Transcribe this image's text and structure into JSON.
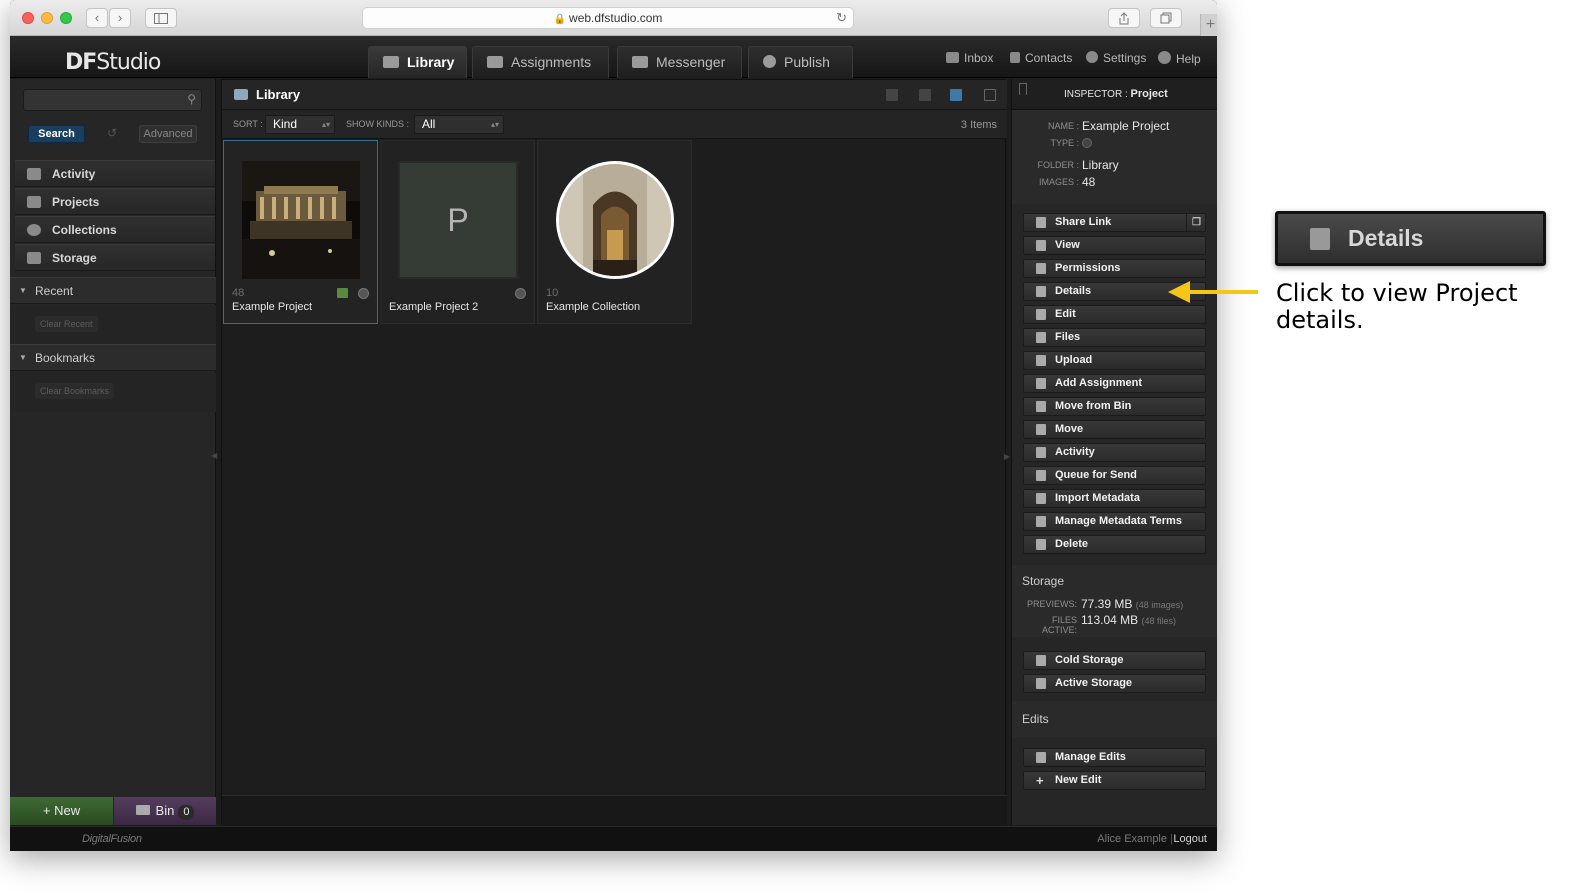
{
  "browser": {
    "url": "web.dfstudio.com",
    "back": "‹",
    "forward": "›",
    "lock": "🔒",
    "reload": "↻",
    "new_tab": "+"
  },
  "app": {
    "logo_a": "DF",
    "logo_b": "Studio",
    "tabs": [
      {
        "label": "Library",
        "icon": "library-icon"
      },
      {
        "label": "Assignments",
        "icon": "assignments-icon"
      },
      {
        "label": "Messenger",
        "icon": "messenger-icon"
      },
      {
        "label": "Publish",
        "icon": "publish-icon"
      }
    ],
    "top_links": [
      {
        "label": "Inbox",
        "icon": "inbox-icon"
      },
      {
        "label": "Contacts",
        "icon": "contacts-icon"
      },
      {
        "label": "Settings",
        "icon": "gear-icon"
      },
      {
        "label": "Help",
        "icon": "help-icon"
      }
    ]
  },
  "sidebar": {
    "search_label": "Search",
    "advanced_label": "Advanced",
    "reset_glyph": "↺",
    "search_glyph": "⚲",
    "items": [
      {
        "label": "Activity",
        "icon": "activity-icon"
      },
      {
        "label": "Projects",
        "icon": "projects-icon"
      },
      {
        "label": "Collections",
        "icon": "collections-icon"
      },
      {
        "label": "Storage",
        "icon": "storage-icon"
      }
    ],
    "recent_label": "Recent",
    "clear_recent": "Clear Recent",
    "bookmarks_label": "Bookmarks",
    "clear_bookmarks": "Clear Bookmarks",
    "triangle": "▼",
    "new_label": "+ New",
    "bin_label": "Bin",
    "bin_count": "0"
  },
  "library": {
    "title": "Library",
    "sort_label": "SORT :",
    "sort_value": "Kind",
    "kinds_label": "SHOW KINDS :",
    "kinds_value": "All",
    "select_arrow": "▴▾",
    "items_count": "3 Items",
    "items": [
      {
        "count": "48",
        "name": "Example Project"
      },
      {
        "count": "",
        "name": "Example Project 2",
        "placeholder_letter": "P"
      },
      {
        "count": "10",
        "name": "Example Collection"
      }
    ]
  },
  "inspector": {
    "title_prefix": "INSPECTOR : ",
    "title_value": "Project",
    "name_key": "NAME :",
    "name_val": "Example Project",
    "type_key": "TYPE :",
    "folder_key": "FOLDER :",
    "folder_val": "Library",
    "images_key": "IMAGES :",
    "images_val": "48",
    "copy_glyph": "❐",
    "actions": [
      {
        "label": "Share Link",
        "icon": "link-icon"
      },
      {
        "label": "View",
        "icon": "view-icon"
      },
      {
        "label": "Permissions",
        "icon": "lock-icon"
      },
      {
        "label": "Details",
        "icon": "details-icon"
      },
      {
        "label": "Edit",
        "icon": "pencil-icon"
      },
      {
        "label": "Files",
        "icon": "files-icon"
      },
      {
        "label": "Upload",
        "icon": "upload-icon"
      },
      {
        "label": "Add Assignment",
        "icon": "assignment-icon"
      },
      {
        "label": "Move from Bin",
        "icon": "arrow-left-icon"
      },
      {
        "label": "Move",
        "icon": "arrow-right-icon"
      },
      {
        "label": "Activity",
        "icon": "activity-icon"
      },
      {
        "label": "Queue for Send",
        "icon": "queue-icon"
      },
      {
        "label": "Import Metadata",
        "icon": "import-icon"
      },
      {
        "label": "Manage Metadata Terms",
        "icon": "list-icon"
      },
      {
        "label": "Delete",
        "icon": "trash-icon"
      }
    ],
    "storage_title": "Storage",
    "previews_key": "PREVIEWS:",
    "previews_val": "77.39 MB",
    "previews_note": "(48 images)",
    "files_key": "FILES ACTIVE:",
    "files_val": "113.04 MB",
    "files_note": "(48 files)",
    "storage_actions": [
      {
        "label": "Cold Storage",
        "icon": "snowflake-icon"
      },
      {
        "label": "Active Storage",
        "icon": "active-storage-icon"
      }
    ],
    "edits_title": "Edits",
    "edit_actions": [
      {
        "label": "Manage Edits",
        "icon": "manage-edits-icon"
      },
      {
        "label": "New Edit",
        "icon": "plus-icon"
      }
    ]
  },
  "status": {
    "brand": "DigitalFusion",
    "user": "Alice Example",
    "separator": "|",
    "logout": "Logout"
  },
  "callout": {
    "button_label": "Details",
    "text": "Click to view Project details."
  },
  "colors": {
    "accent_blue": "#2f6f92",
    "arrow_yellow": "#f5c518",
    "new_green": "#3f6a33",
    "bin_purple": "#553c5e"
  }
}
